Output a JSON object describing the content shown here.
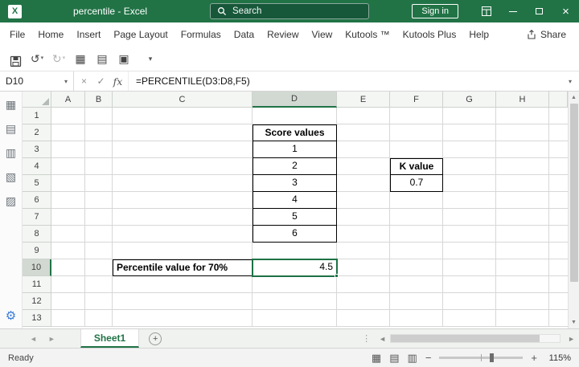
{
  "titlebar": {
    "title": "percentile - Excel",
    "search_placeholder": "Search",
    "sign_in_label": "Sign in"
  },
  "menubar": {
    "tabs": [
      "File",
      "Home",
      "Insert",
      "Page Layout",
      "Formulas",
      "Data",
      "Review",
      "View",
      "Kutools ™",
      "Kutools Plus",
      "Help"
    ],
    "share_label": "Share"
  },
  "formula_bar": {
    "name_box": "D10",
    "fx_label": "fx",
    "formula": "=PERCENTILE(D3:D8,F5)"
  },
  "grid": {
    "columns": [
      "A",
      "B",
      "C",
      "D",
      "E",
      "F",
      "G",
      "H"
    ],
    "rows": [
      "1",
      "2",
      "3",
      "4",
      "5",
      "6",
      "7",
      "8",
      "9",
      "10",
      "11",
      "12",
      "13"
    ],
    "selected_column": "D",
    "selected_row": "10",
    "active_cell": "D10",
    "cells": [
      {
        "ref": "D2",
        "value": "Score values",
        "bold": true,
        "align": "center",
        "borders": "tlrb"
      },
      {
        "ref": "D3",
        "value": "1",
        "align": "center",
        "borders": "lrb"
      },
      {
        "ref": "D4",
        "value": "2",
        "align": "center",
        "borders": "lrb"
      },
      {
        "ref": "D5",
        "value": "3",
        "align": "center",
        "borders": "lrb"
      },
      {
        "ref": "D6",
        "value": "4",
        "align": "center",
        "borders": "lrb"
      },
      {
        "ref": "D7",
        "value": "5",
        "align": "center",
        "borders": "lrb"
      },
      {
        "ref": "D8",
        "value": "6",
        "align": "center",
        "borders": "lrb"
      },
      {
        "ref": "F4",
        "value": "K value",
        "bold": true,
        "align": "center",
        "borders": "tlrb"
      },
      {
        "ref": "F5",
        "value": "0.7",
        "align": "center",
        "borders": "lrb"
      },
      {
        "ref": "C10",
        "value": "Percentile value for 70%",
        "bold": true,
        "align": "left",
        "borders": "tlrb"
      },
      {
        "ref": "D10",
        "value": "4.5",
        "align": "right",
        "active": true
      }
    ]
  },
  "sheet_tabs": {
    "tabs": [
      "Sheet1"
    ],
    "active_tab": "Sheet1"
  },
  "status_bar": {
    "status": "Ready",
    "zoom_level": "115%"
  },
  "icons": {
    "chevron": "▾",
    "cancel": "×",
    "check": "✓",
    "undo": "↺",
    "redo": "↻",
    "nav_left": "◄",
    "nav_right": "►",
    "up": "▲",
    "down": "▼",
    "plus": "+",
    "minus": "−",
    "dots": "⋮",
    "gear": "⚙",
    "kutools": [
      "▦",
      "▤",
      "▥",
      "▧",
      "▨"
    ],
    "qat": [
      "▦",
      "▤",
      "▣"
    ],
    "views": [
      "▦",
      "▤",
      "▥"
    ]
  }
}
